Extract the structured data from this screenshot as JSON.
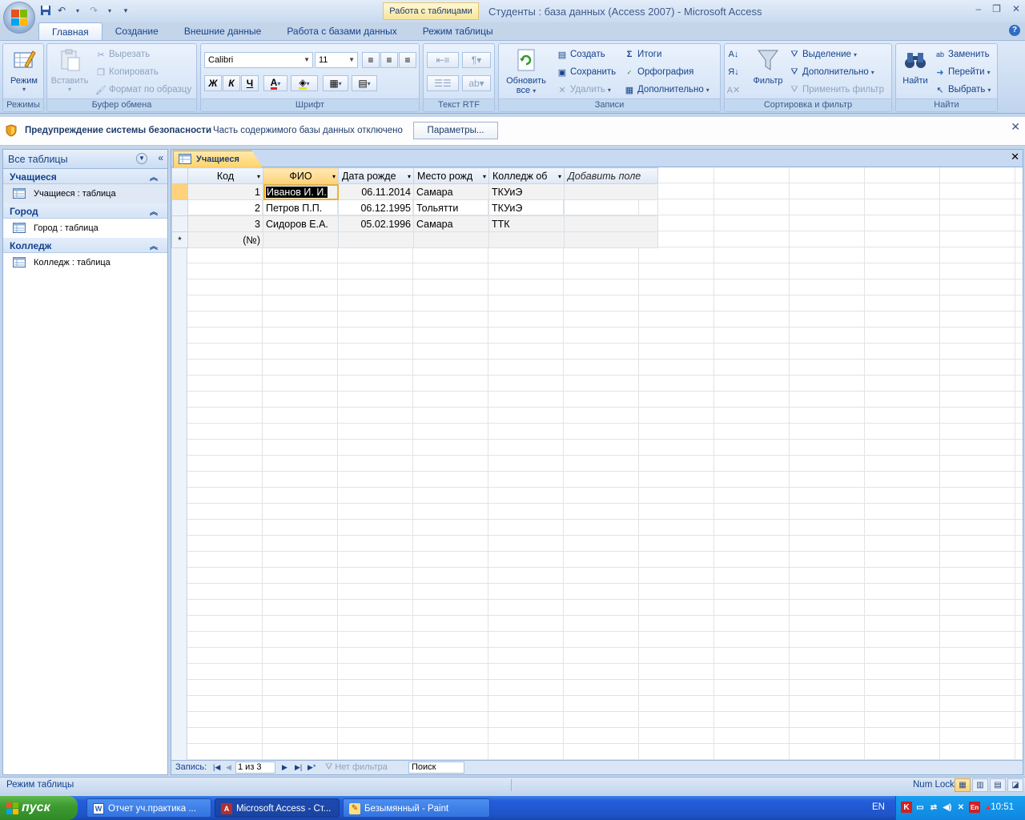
{
  "window": {
    "app_title": "Студенты : база данных (Access 2007) - Microsoft Access",
    "context_tab_title": "Работа с таблицами"
  },
  "ribbon_tabs": [
    {
      "label": "Главная",
      "active": true
    },
    {
      "label": "Создание"
    },
    {
      "label": "Внешние данные"
    },
    {
      "label": "Работа с базами данных"
    },
    {
      "label": "Режим таблицы"
    }
  ],
  "ribbon": {
    "modes": {
      "title": "Режимы",
      "mode_btn": "Режим"
    },
    "clipboard": {
      "title": "Буфер обмена",
      "paste": "Вставить",
      "cut": "Вырезать",
      "copy": "Копировать",
      "format_painter": "Формат по образцу"
    },
    "font": {
      "title": "Шрифт",
      "font_name": "Calibri",
      "font_size": "11",
      "bold": "Ж",
      "italic": "К",
      "underline": "Ч",
      "font_color": "A"
    },
    "rtf": {
      "title": "Текст RTF"
    },
    "records": {
      "title": "Записи",
      "refresh_all": "Обновить",
      "refresh_all2": "все",
      "new": "Создать",
      "save": "Сохранить",
      "delete": "Удалить",
      "totals": "Итоги",
      "spelling": "Орфография",
      "more": "Дополнительно"
    },
    "sort_filter": {
      "title": "Сортировка и фильтр",
      "filter": "Фильтр",
      "selection": "Выделение",
      "advanced": "Дополнительно",
      "toggle_filter": "Применить фильтр"
    },
    "find": {
      "title": "Найти",
      "find": "Найти",
      "replace": "Заменить",
      "goto": "Перейти",
      "select": "Выбрать"
    }
  },
  "security_bar": {
    "title": "Предупреждение системы безопасности",
    "message": "Часть содержимого базы данных отключено",
    "options_button": "Параметры..."
  },
  "nav_pane": {
    "header": "Все таблицы",
    "groups": [
      {
        "title": "Учащиеся",
        "item": "Учащиеся : таблица"
      },
      {
        "title": "Город",
        "item": "Город : таблица"
      },
      {
        "title": "Колледж",
        "item": "Колледж : таблица"
      }
    ]
  },
  "document": {
    "tab_label": "Учащиеся",
    "columns": [
      "Код",
      "ФИО",
      "Дата рожде",
      "Место рожд",
      "Колледж об",
      "Добавить поле"
    ],
    "rows": [
      [
        "1",
        "Иванов И. И.",
        "06.11.2014",
        "Самара",
        "ТКУиЭ"
      ],
      [
        "2",
        "Петров П.П.",
        "06.12.1995",
        "Тольятти",
        "ТКУиЭ"
      ],
      [
        "3",
        "Сидоров Е.А.",
        "05.02.1996",
        "Самара",
        "ТТК"
      ]
    ],
    "new_row_marker": "*",
    "new_row_id": "(№)"
  },
  "record_nav": {
    "label": "Запись:",
    "position": "1 из 3",
    "filter": "Нет фильтра",
    "search": "Поиск"
  },
  "statusbar": {
    "mode": "Режим таблицы",
    "numlock": "Num Lock"
  },
  "taskbar": {
    "start": "пуск",
    "tasks": [
      "Отчет уч.практика ...",
      "Microsoft Access - Ст...",
      "Безымянный - Paint"
    ],
    "lang": "EN",
    "clock": "10:51"
  }
}
